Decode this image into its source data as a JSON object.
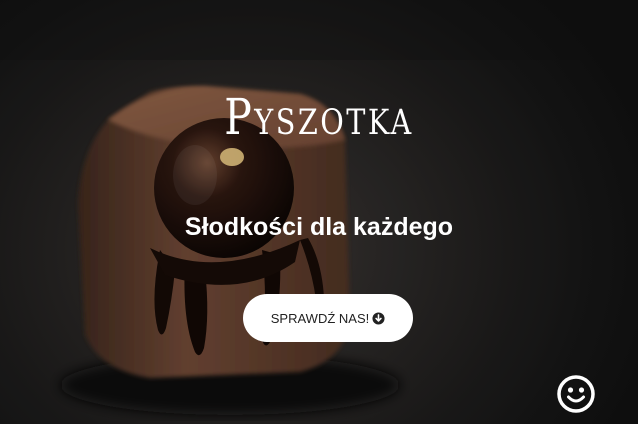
{
  "hero": {
    "brand_title": "Pyszotka",
    "tagline": "Słodkości dla każdego",
    "cta_label": "SPRAWDŹ NAS!",
    "cta_icon": "arrow-down-circle-icon",
    "corner_icon": "smiley-icon"
  },
  "colors": {
    "background": "#131313",
    "text": "#ffffff",
    "button_bg": "#ffffff",
    "button_text": "#222222"
  }
}
